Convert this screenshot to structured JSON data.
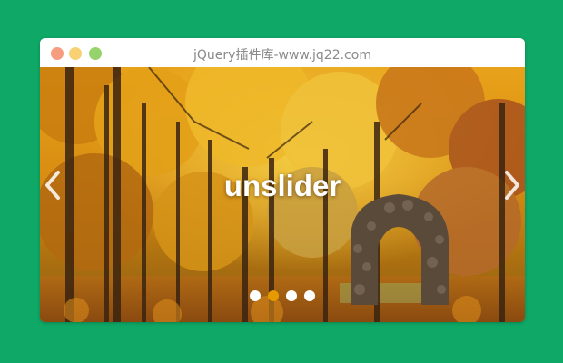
{
  "window": {
    "title": "jQuery插件库-www.jq22.com",
    "controls": [
      {
        "name": "close",
        "color": "#f59d7e"
      },
      {
        "name": "minimize",
        "color": "#f7d173"
      },
      {
        "name": "maximize",
        "color": "#96d36c"
      }
    ]
  },
  "slider": {
    "caption": "unslider",
    "prev_icon": "chevron-left-icon",
    "next_icon": "chevron-right-icon",
    "pagination": {
      "count": 4,
      "active_index": 1,
      "active_color": "#e59a00",
      "inactive_color": "#ffffff"
    }
  },
  "colors": {
    "page_background": "#0fa866"
  }
}
